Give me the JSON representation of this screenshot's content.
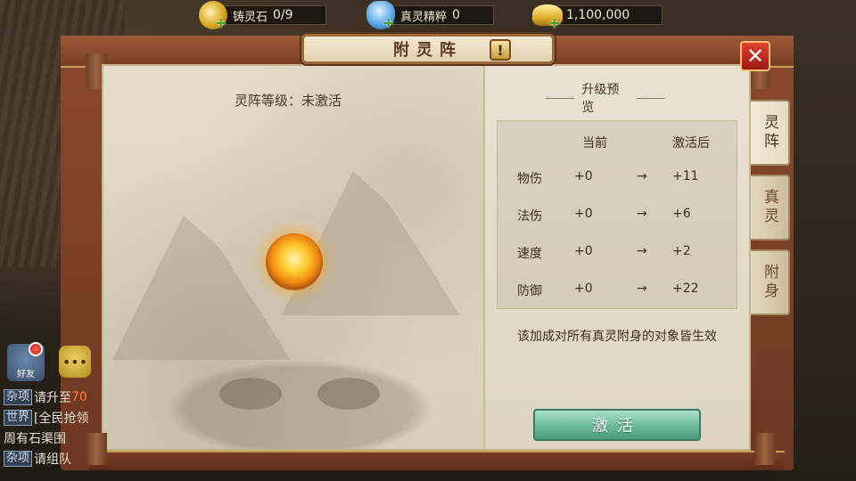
{
  "resources": [
    {
      "icon": "soul-stone-icon",
      "label": "铸灵石",
      "value": "0/9"
    },
    {
      "icon": "spirit-essence-icon",
      "label": "真灵精粹",
      "value": "0"
    },
    {
      "icon": "gold-ingot-icon",
      "label": "",
      "value": "1,100,000"
    }
  ],
  "panel": {
    "title": "附灵阵",
    "info_label": "!",
    "close_label": "✕"
  },
  "level": {
    "text": "灵阵等级：未激活"
  },
  "preview": {
    "title": "升级预览",
    "headers": {
      "current": "当前",
      "after": "激活后"
    },
    "arrow": "→",
    "rows": [
      {
        "name": "物伤",
        "current": "+0",
        "after": "+11"
      },
      {
        "name": "法伤",
        "current": "+0",
        "after": "+6"
      },
      {
        "name": "速度",
        "current": "+0",
        "after": "+2"
      },
      {
        "name": "防御",
        "current": "+0",
        "after": "+22"
      }
    ],
    "note": "该加成对所有真灵附身的对象皆生效"
  },
  "activate_button": "激活",
  "tabs": [
    {
      "label": "灵阵",
      "active": true
    },
    {
      "label": "真灵",
      "active": false
    },
    {
      "label": "附身",
      "active": false
    }
  ],
  "chat": {
    "friend_label": "好友",
    "lines": [
      {
        "tag": "杂项",
        "text": "请升至",
        "highlight": "70"
      },
      {
        "tag": "世界",
        "text": "[全民抢领",
        "highlight": ""
      },
      {
        "tag": "",
        "text": "周有石渠围",
        "highlight": ""
      },
      {
        "tag": "杂项",
        "text": "请组队",
        "highlight": ""
      }
    ]
  }
}
